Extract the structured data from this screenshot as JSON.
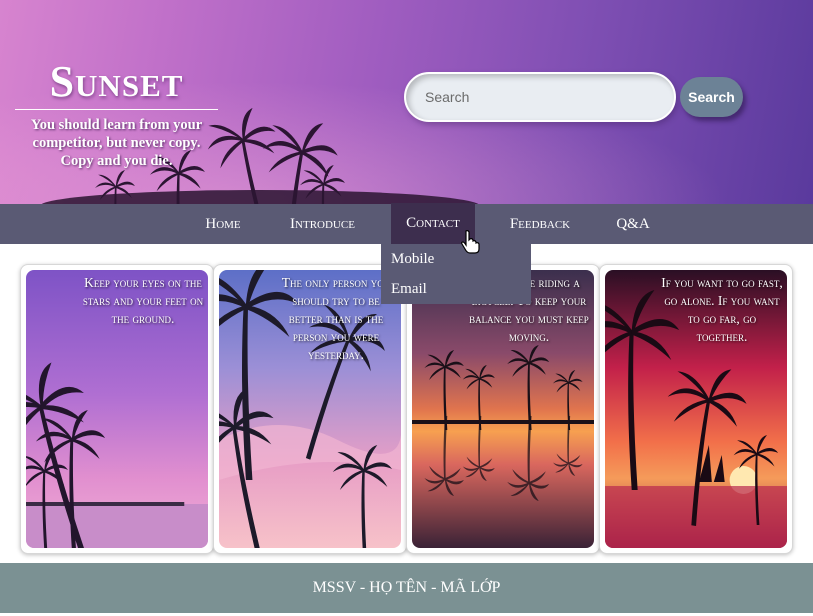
{
  "header": {
    "title": "Sunset",
    "tagline": "You should learn from your competitor, but never copy. Copy and you die.",
    "search": {
      "placeholder": "Search",
      "value": "",
      "button_label": "Search"
    }
  },
  "nav": {
    "items": [
      {
        "label": "Home"
      },
      {
        "label": "Introduce"
      },
      {
        "label": "Contact",
        "active": true
      },
      {
        "label": "Feedback"
      },
      {
        "label": "Q&A"
      }
    ],
    "dropdown": [
      "Mobile",
      "Email"
    ]
  },
  "cards": [
    {
      "quote": "Keep your eyes on the stars and your feet on the ground."
    },
    {
      "quote": "The only person you should try to be better than is the person you were yesterday."
    },
    {
      "quote": "Life is like riding a bicycle. To keep your balance you must keep moving."
    },
    {
      "quote": "If you want to go fast, go alone. If you want to go far, go together."
    }
  ],
  "footer": {
    "text": "MSSV - HỌ TÊN - MÃ LỚP"
  },
  "colors": {
    "nav_bg": "#5a5a74",
    "nav_active": "#3d2e4e",
    "search_button": "#6c8296",
    "footer_bg": "#7b9193"
  }
}
